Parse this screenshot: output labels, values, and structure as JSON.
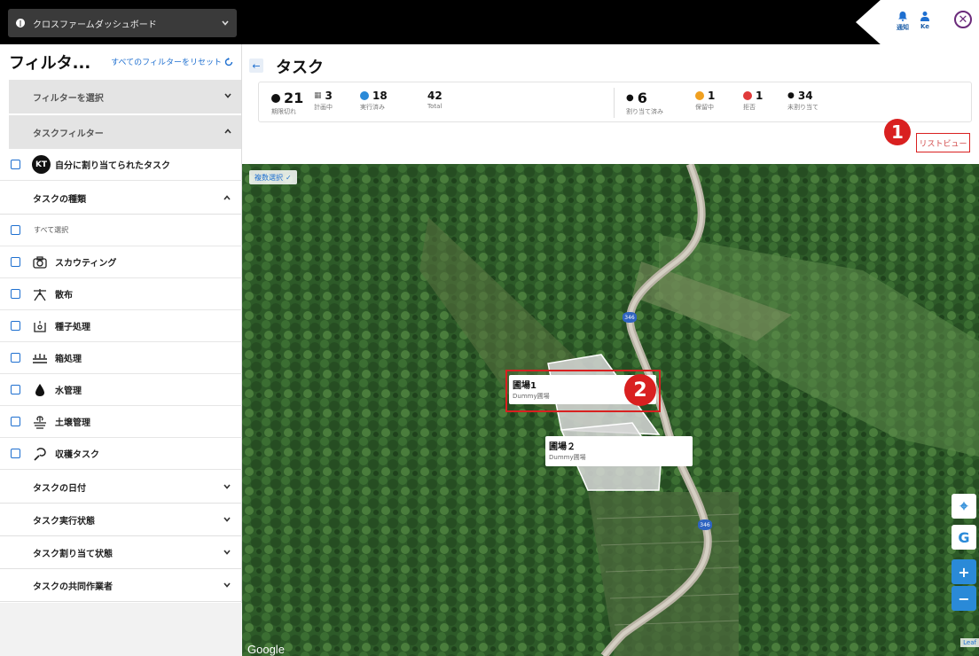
{
  "topbar": {
    "farm_name": "クロスファームダッシュボード",
    "notify_label": "通知",
    "user_label": "Ke"
  },
  "sidebar": {
    "title": "フィルタ...",
    "reset_label": "すべてのフィルターをリセット",
    "select_filter_label": "フィルターを選択",
    "task_filter_label": "タスクフィルター",
    "assigned_to_me": {
      "badge": "KT",
      "label": "自分に割り当てられたタスク"
    },
    "task_type_header": "タスクの種類",
    "select_all_label": "すべて選択",
    "task_types": [
      {
        "label": "スカウティング",
        "icon": "camera-icon"
      },
      {
        "label": "散布",
        "icon": "sprayer-icon"
      },
      {
        "label": "種子処理",
        "icon": "seed-treatment-icon"
      },
      {
        "label": "箱処理",
        "icon": "box-treatment-icon"
      },
      {
        "label": "水管理",
        "icon": "water-drop-icon"
      },
      {
        "label": "土壌管理",
        "icon": "soil-icon"
      },
      {
        "label": "収穫タスク",
        "icon": "sickle-icon"
      }
    ],
    "sections": [
      {
        "label": "タスクの日付"
      },
      {
        "label": "タスク実行状態"
      },
      {
        "label": "タスク割り当て状態"
      },
      {
        "label": "タスクの共同作業者"
      }
    ]
  },
  "main": {
    "title": "タスク",
    "stats": [
      {
        "value": "21",
        "label": "期限切れ"
      },
      {
        "value": "3",
        "label": "計画中"
      },
      {
        "value": "18",
        "label": "実行済み"
      },
      {
        "value": "42",
        "label": "Total"
      },
      {
        "value": "6",
        "label": "割り当て済み"
      },
      {
        "value": "1",
        "label": "保留中"
      },
      {
        "value": "1",
        "label": "拒否"
      },
      {
        "value": "34",
        "label": "未割り当て"
      }
    ],
    "list_view_label": "リストビュー",
    "callout_1": "1",
    "callout_2": "2"
  },
  "map": {
    "multi_select_label": "複数選択",
    "fields": [
      {
        "name": "圃場1",
        "sub": "Dummy圃場"
      },
      {
        "name": "圃場２",
        "sub": "Dummy圃場"
      }
    ],
    "route_number": "346",
    "google_label": "Google",
    "leaflet_label": "Leaf",
    "controls": {
      "locate": "⌖",
      "google": "G",
      "zoom_in": "+",
      "zoom_out": "−"
    }
  },
  "colors": {
    "accent_blue": "#1e6fd0",
    "highlight_red": "#d92020",
    "topbar_bg": "#000000"
  }
}
